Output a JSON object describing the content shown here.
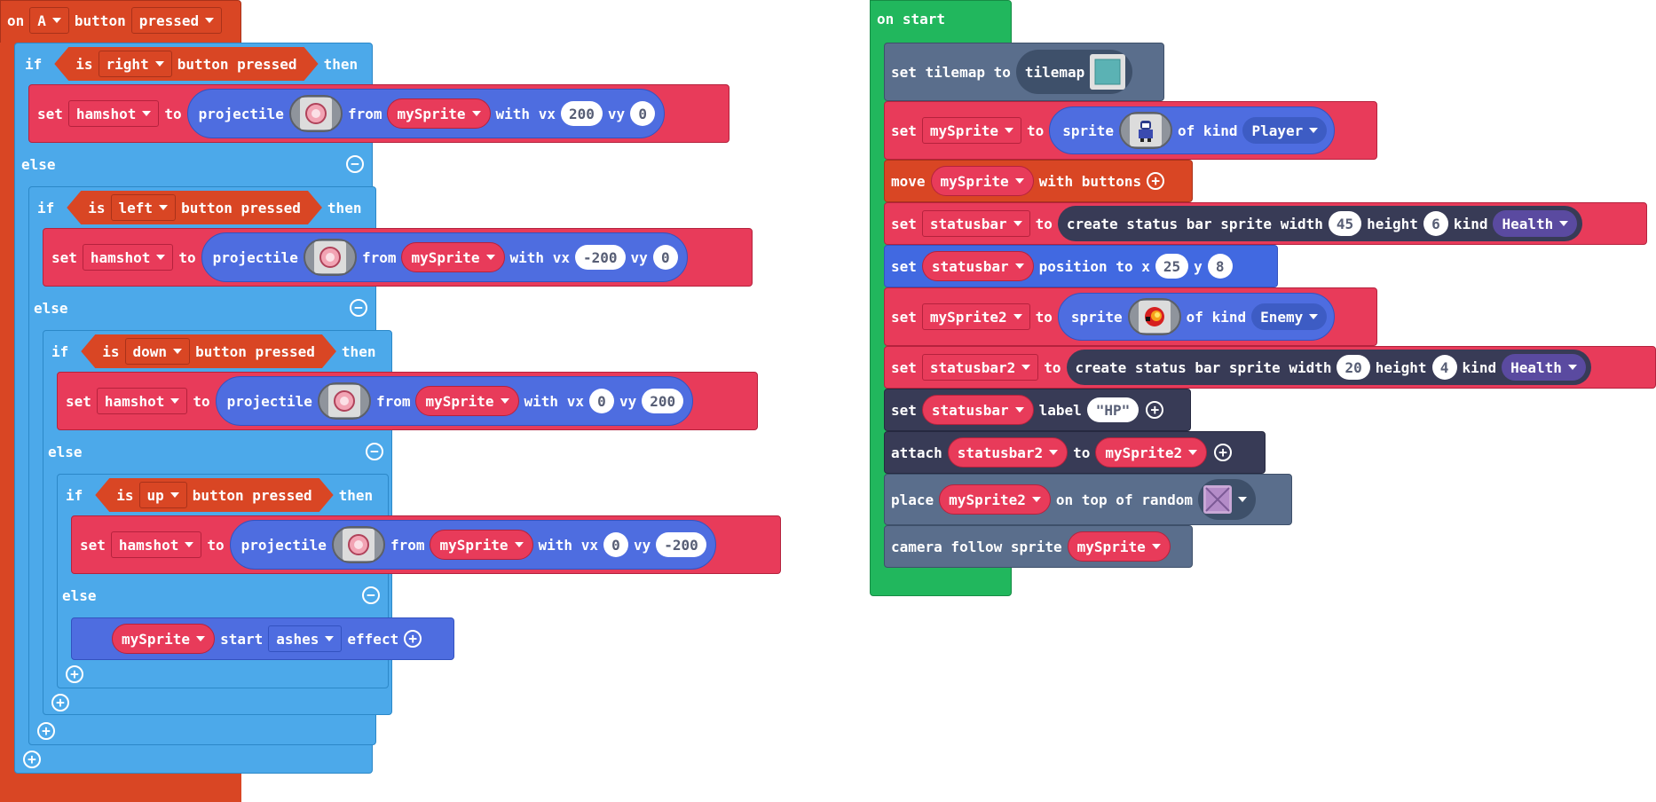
{
  "colors": {
    "event": "#d94624",
    "logic": "#4ca9ea",
    "sprites": "#e83b5a",
    "scene": "#5a6e8c",
    "controller": "#d94624",
    "statusbar": "#383b56",
    "on_start": "#21b75d"
  },
  "on_a": {
    "on": "on",
    "button": "A",
    "button_word": "button",
    "event": "pressed",
    "if1": {
      "if_word": "if",
      "is_word": "is",
      "dir": "right",
      "pressed": "button pressed",
      "then": "then"
    },
    "set1": {
      "set": "set",
      "var": "hamshot",
      "to": "to",
      "projectile": "projectile",
      "from": "from",
      "sprite": "mySprite",
      "with_vx": "with vx",
      "vx": "200",
      "vy_word": "vy",
      "vy": "0",
      "image_icon": "ham-icon"
    },
    "else1": "else",
    "if2": {
      "if_word": "if",
      "is_word": "is",
      "dir": "left",
      "pressed": "button pressed",
      "then": "then"
    },
    "set2": {
      "set": "set",
      "var": "hamshot",
      "to": "to",
      "projectile": "projectile",
      "from": "from",
      "sprite": "mySprite",
      "with_vx": "with vx",
      "vx": "-200",
      "vy_word": "vy",
      "vy": "0"
    },
    "else2": "else",
    "if3": {
      "if_word": "if",
      "is_word": "is",
      "dir": "down",
      "pressed": "button pressed",
      "then": "then"
    },
    "set3": {
      "set": "set",
      "var": "hamshot",
      "to": "to",
      "projectile": "projectile",
      "from": "from",
      "sprite": "mySprite",
      "with_vx": "with vx",
      "vx": "0",
      "vy_word": "vy",
      "vy": "200"
    },
    "else3": "else",
    "if4": {
      "if_word": "if",
      "is_word": "is",
      "dir": "up",
      "pressed": "button pressed",
      "then": "then"
    },
    "set4": {
      "set": "set",
      "var": "hamshot",
      "to": "to",
      "projectile": "projectile",
      "from": "from",
      "sprite": "mySprite",
      "with_vx": "with vx",
      "vx": "0",
      "vy_word": "vy",
      "vy": "-200"
    },
    "else4": "else",
    "effect": {
      "sprite": "mySprite",
      "start": "start",
      "effect_name": "ashes",
      "effect": "effect"
    }
  },
  "on_start": {
    "title": "on start",
    "b1": {
      "set": "set tilemap to",
      "tilemap": "tilemap"
    },
    "b2": {
      "set": "set",
      "var": "mySprite",
      "to": "to",
      "sprite": "sprite",
      "of_kind": "of kind",
      "kind": "Player"
    },
    "b3": {
      "move": "move",
      "sprite": "mySprite",
      "with": "with buttons"
    },
    "b4": {
      "set": "set",
      "var": "statusbar",
      "to": "to",
      "create": "create status bar sprite width",
      "width": "45",
      "height_word": "height",
      "height": "6",
      "kind_word": "kind",
      "kind": "Health"
    },
    "b5": {
      "set": "set",
      "var": "statusbar",
      "pos": "position to x",
      "x": "25",
      "y_word": "y",
      "y": "8"
    },
    "b6": {
      "set": "set",
      "var": "mySprite2",
      "to": "to",
      "sprite": "sprite",
      "of_kind": "of kind",
      "kind": "Enemy"
    },
    "b7": {
      "set": "set",
      "var": "statusbar2",
      "to": "to",
      "create": "create status bar sprite width",
      "width": "20",
      "height_word": "height",
      "height": "4",
      "kind_word": "kind",
      "kind": "Health"
    },
    "b8": {
      "set": "set",
      "var": "statusbar",
      "label": "label",
      "value": "\"HP\""
    },
    "b9": {
      "attach": "attach",
      "var": "statusbar2",
      "to": "to",
      "target": "mySprite2"
    },
    "b10": {
      "place": "place",
      "var": "mySprite2",
      "on_top": "on top of random"
    },
    "b11": {
      "camera": "camera follow sprite",
      "var": "mySprite"
    }
  }
}
